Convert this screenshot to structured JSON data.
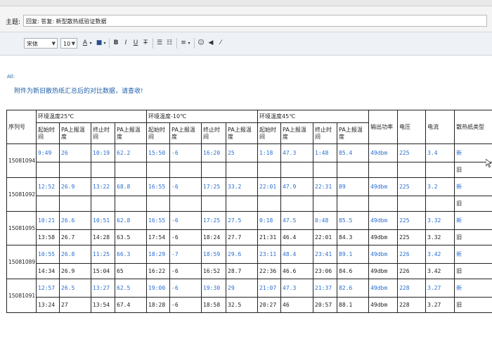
{
  "subject": {
    "label": "主题:",
    "value": "回复: 答复: 新型散热纸验证数据"
  },
  "toolbar": {
    "font": "宋体",
    "size": "10",
    "buttons": {
      "font_color": "A",
      "highlight": "■",
      "bold": "B",
      "italic": "I",
      "underline": "U",
      "strike": "T",
      "ordered": "☰",
      "unordered": "☷",
      "align": "≡",
      "emoji": "☺",
      "link": "◀",
      "clear": "⁄"
    }
  },
  "message": {
    "salutation": "All:",
    "body": "附件为新旧散热纸汇总后的对比数据，请查收!"
  },
  "table": {
    "groups": {
      "serial": "序列号",
      "env25": "环境温度25℃",
      "envm10": "环境温度-10℃",
      "env45": "环境温度45℃",
      "power": "输出功率",
      "voltage": "电压",
      "current": "电流",
      "paper": "散热纸类型"
    },
    "sub": {
      "start": "起始时间",
      "pa": "PA上报温度",
      "end": "终止时间"
    },
    "serials": [
      "15081094",
      "15081092",
      "15081095",
      "15081089",
      "15081091"
    ],
    "rows": [
      [
        "9:49",
        "26",
        "10:19",
        "62.2",
        "15:50",
        "-6",
        "16:20",
        "25",
        "1:18",
        "47.3",
        "1:48",
        "85.4",
        "49dbm",
        "225",
        "3.4",
        "新"
      ],
      [
        "",
        "",
        "",
        "",
        "",
        "",
        "",
        "",
        "",
        "",
        "",
        "",
        "",
        "",
        "",
        "旧"
      ],
      [
        "12:52",
        "26.9",
        "13:22",
        "68.8",
        "16:55",
        "-6",
        "17:25",
        "33.2",
        "22:01",
        "47.9",
        "22:31",
        "89",
        "49dbm",
        "225",
        "3.2",
        "新"
      ],
      [
        "",
        "",
        "",
        "",
        "",
        "",
        "",
        "",
        "",
        "",
        "",
        "",
        "",
        "",
        "",
        "旧"
      ],
      [
        "10:21",
        "26.6",
        "10:51",
        "62.8",
        "16:55",
        "-6",
        "17:25",
        "27.5",
        "0:18",
        "47.5",
        "0:48",
        "85.5",
        "49dbm",
        "225",
        "3.32",
        "新"
      ],
      [
        "13:58",
        "26.7",
        "14:28",
        "63.5",
        "17:54",
        "-6",
        "18:24",
        "27.7",
        "21:31",
        "46.4",
        "22:01",
        "84.3",
        "49dbm",
        "225",
        "3.32",
        "旧"
      ],
      [
        "10:55",
        "26.8",
        "11:25",
        "66.3",
        "18:29",
        "-7",
        "18:59",
        "29.6",
        "23:11",
        "48.4",
        "23:41",
        "89.1",
        "49dbm",
        "226",
        "3.42",
        "新"
      ],
      [
        "14:34",
        "26.9",
        "15:04",
        "65",
        "16:22",
        "-6",
        "16:52",
        "28.7",
        "22:36",
        "46.6",
        "23:06",
        "84.6",
        "49dbm",
        "226",
        "3.42",
        "旧"
      ],
      [
        "12:57",
        "26.5",
        "13:27",
        "62.5",
        "19:00",
        "-6",
        "19:30",
        "29",
        "21:07",
        "47.3",
        "21:37",
        "82.6",
        "49dbm",
        "228",
        "3.27",
        "新"
      ],
      [
        "13:24",
        "27",
        "13:54",
        "67.4",
        "18:28",
        "-6",
        "18:58",
        "32.5",
        "20:27",
        "46",
        "20:57",
        "88.1",
        "49dbm",
        "228",
        "3.27",
        "旧"
      ]
    ]
  },
  "colors": {
    "message_text": "#1f5fa8",
    "new_row_values": "#2a6fd0"
  }
}
